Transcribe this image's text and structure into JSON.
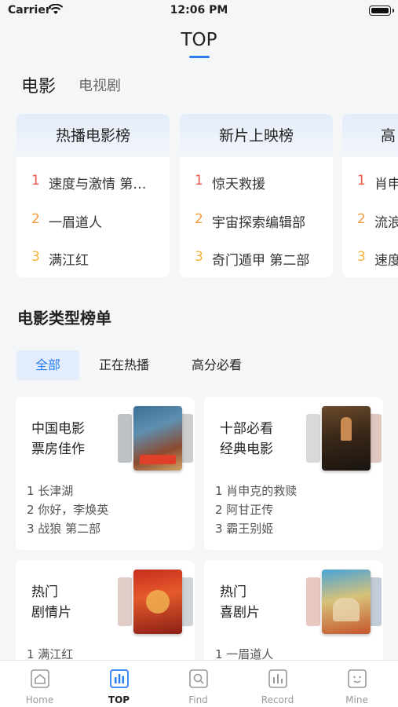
{
  "status_bar": {
    "carrier": "Carrier",
    "time": "12:06 PM"
  },
  "header": {
    "title": "TOP"
  },
  "category_tabs": [
    {
      "label": "电影"
    },
    {
      "label": "电视剧"
    }
  ],
  "rank_cards": [
    {
      "title": "热播电影榜",
      "items": [
        {
          "rank": "1",
          "name": "速度与激情 第…"
        },
        {
          "rank": "2",
          "name": "一眉道人"
        },
        {
          "rank": "3",
          "name": "满江红"
        }
      ]
    },
    {
      "title": "新片上映榜",
      "items": [
        {
          "rank": "1",
          "name": "惊天救援"
        },
        {
          "rank": "2",
          "name": "宇宙探索编辑部"
        },
        {
          "rank": "3",
          "name": "奇门遁甲 第二部"
        }
      ]
    },
    {
      "title": "高",
      "items": [
        {
          "rank": "1",
          "name": "肖申"
        },
        {
          "rank": "2",
          "name": "流浪"
        },
        {
          "rank": "3",
          "name": "速度"
        }
      ]
    }
  ],
  "genre_section": {
    "title": "电影类型榜单",
    "filters": [
      {
        "label": "全部"
      },
      {
        "label": "正在热播"
      },
      {
        "label": "高分必看"
      }
    ],
    "cards": [
      {
        "title": "中国电影\n票房佳作",
        "items": [
          "1 长津湖",
          "2 你好，李焕英",
          "3 战狼 第二部"
        ]
      },
      {
        "title": "十部必看\n经典电影",
        "items": [
          "1 肖申克的救赎",
          "2 阿甘正传",
          "3 霸王别姬"
        ]
      },
      {
        "title": "热门\n剧情片",
        "items": [
          "1 满江红"
        ]
      },
      {
        "title": "热门\n喜剧片",
        "items": [
          "1 一眉道人"
        ]
      }
    ]
  },
  "tab_bar": [
    {
      "label": "Home",
      "icon": "home-icon"
    },
    {
      "label": "TOP",
      "icon": "chart-icon"
    },
    {
      "label": "Find",
      "icon": "find-icon"
    },
    {
      "label": "Record",
      "icon": "record-icon"
    },
    {
      "label": "Mine",
      "icon": "mine-icon"
    }
  ],
  "colors": {
    "accent": "#2a7ef1",
    "rank1": "#f05a4a",
    "rank2": "#f09a3e",
    "rank3": "#f2b23a"
  }
}
